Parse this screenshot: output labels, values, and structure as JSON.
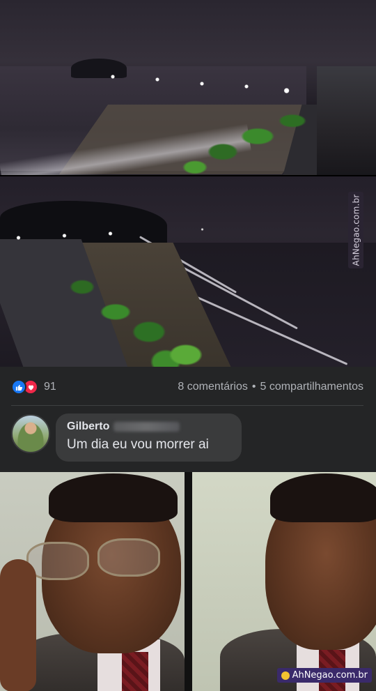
{
  "photos": {
    "top_alt": "night beach promenade",
    "bottom_alt": "aerial night beach"
  },
  "watermark": {
    "side_text": "AhNegao.com.br",
    "bottom_text": "AhNegao.com.br"
  },
  "post": {
    "reaction_count": "91",
    "comments": "8 comentários",
    "separator": "•",
    "shares": "5 compartilhamentos",
    "reactions": [
      "like-icon",
      "love-icon"
    ],
    "colors": {
      "like": "#1877f2",
      "love": "#f02849",
      "background": "#242526"
    }
  },
  "comment": {
    "author": "Gilberto",
    "text": "Um dia eu vou morrer ai"
  }
}
